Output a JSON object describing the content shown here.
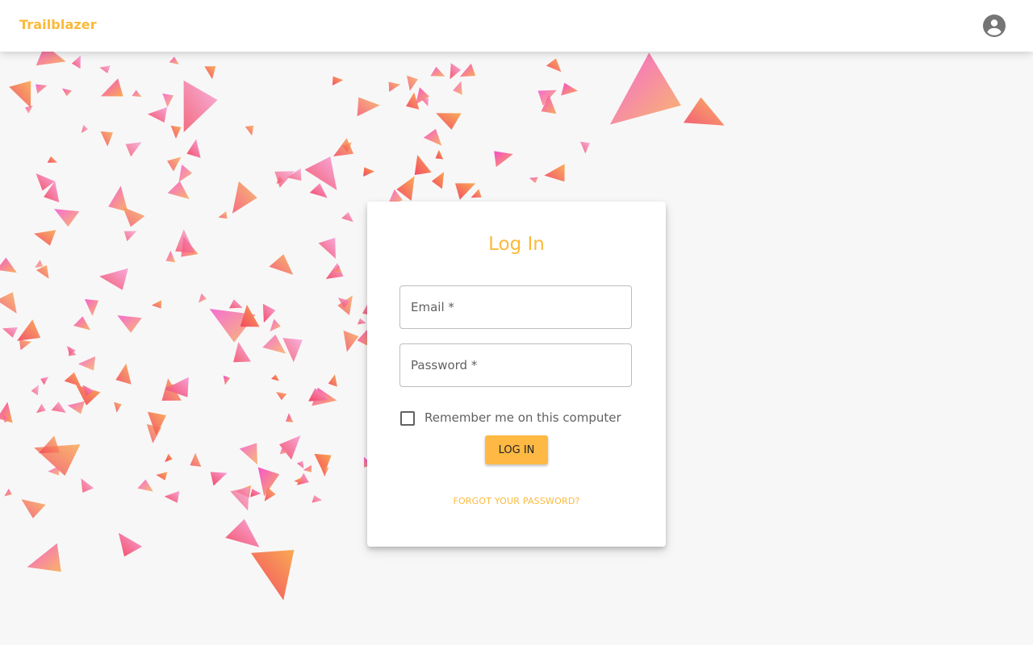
{
  "app": {
    "brand": "Trailblazer",
    "account_icon": "account-circle-icon"
  },
  "login": {
    "title": "Log In",
    "email_label": "Email *",
    "password_label": "Password *",
    "remember_label": "Remember me on this computer",
    "remember_checked": false,
    "submit_label": "LOG IN",
    "forgot_label": "FORGOT YOUR PASSWORD?"
  },
  "colors": {
    "accent": "#fbb93a",
    "button": "#fdb944",
    "shard_pink": "#f447c8",
    "shard_orange": "#f9a84e",
    "shard_red": "#f2455f"
  }
}
